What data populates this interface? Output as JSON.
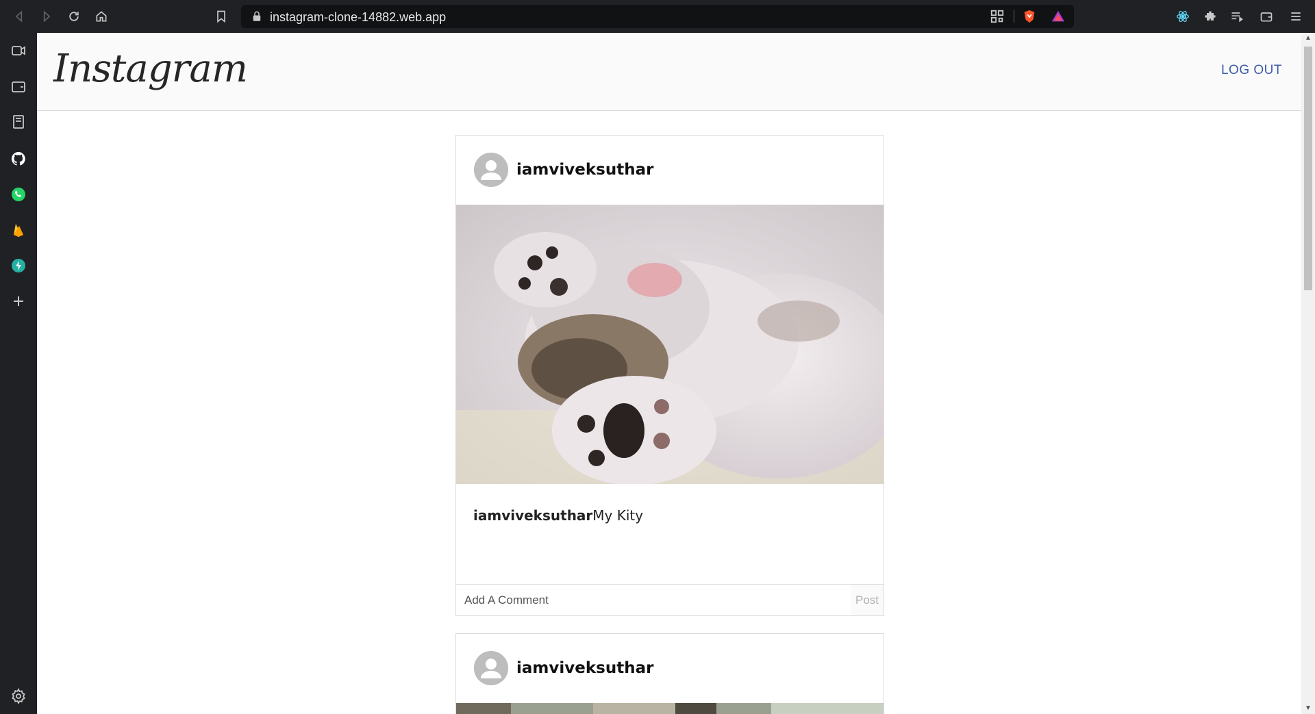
{
  "browser": {
    "url": "instagram-clone-14882.web.app"
  },
  "app": {
    "logo_text": "Instagram",
    "logout_label": "LOG OUT"
  },
  "posts": [
    {
      "username": "iamviveksuthar",
      "caption_user": "iamviveksuthar",
      "caption_text": "My Kity",
      "comment_placeholder": "Add A Comment",
      "post_label": "Post"
    },
    {
      "username": "iamviveksuthar"
    }
  ],
  "colors": {
    "browser_chrome": "#202124",
    "logout_link": "#3e5ba9",
    "border": "#dbdbdb"
  }
}
